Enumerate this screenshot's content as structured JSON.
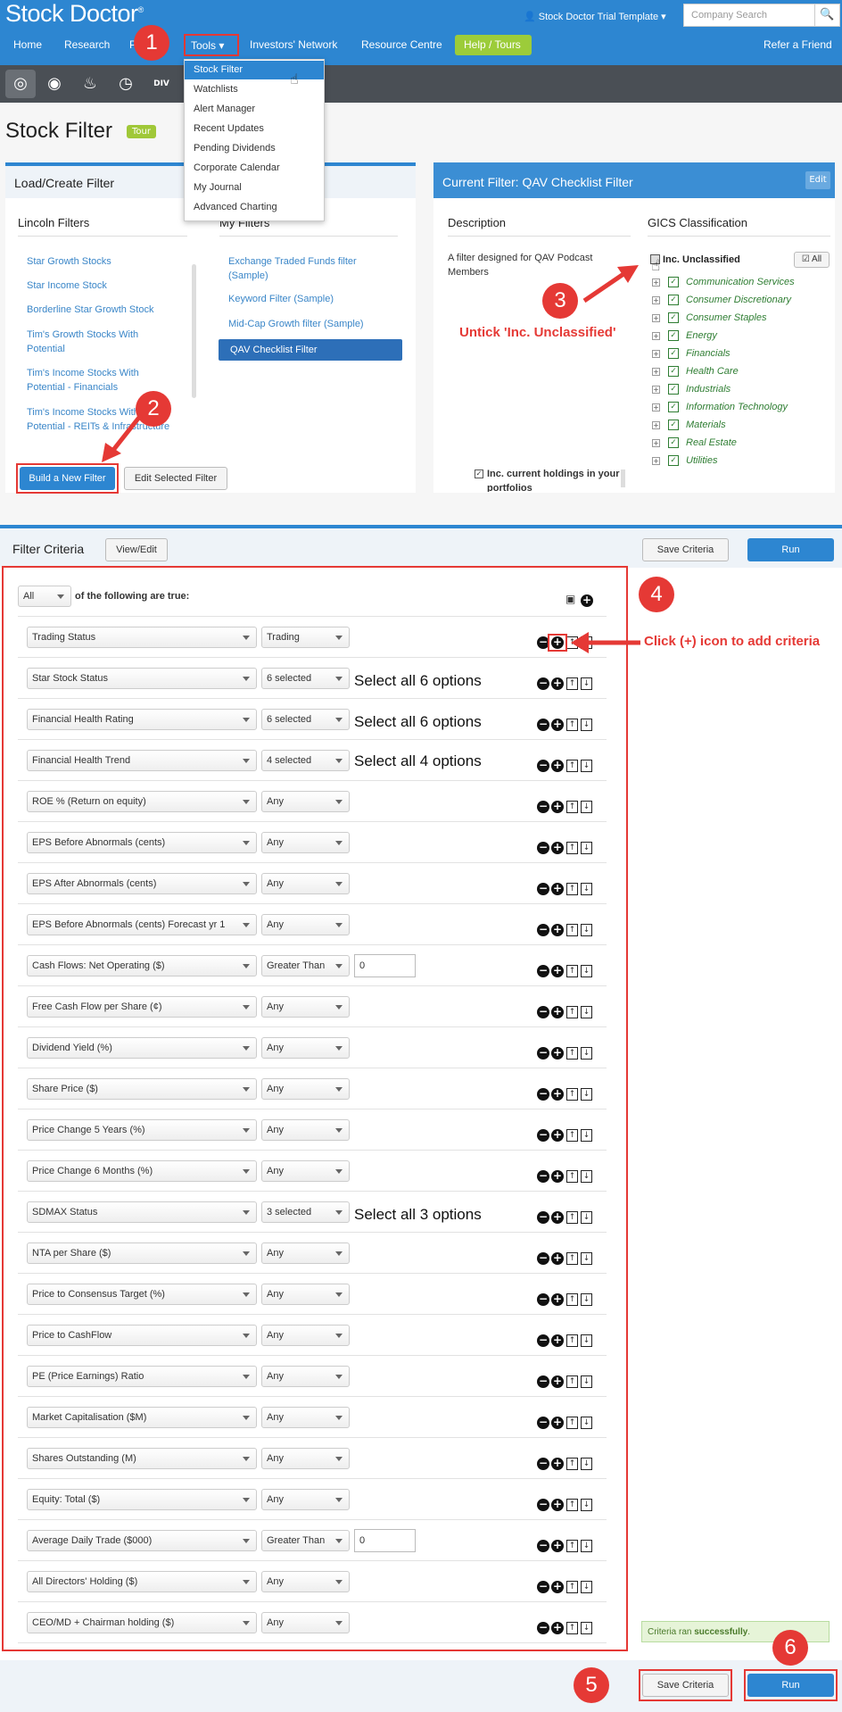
{
  "header": {
    "logo": "Stock Doctor",
    "user": "Stock Doctor Trial Template",
    "search_placeholder": "Company Search",
    "nav": [
      "Home",
      "Research",
      "P",
      "Tools",
      "Investors' Network",
      "Resource Centre",
      "Help / Tours",
      "Refer a Friend"
    ]
  },
  "toolbar": {
    "icons": [
      "target-icon",
      "binoculars-icon",
      "bell-icon",
      "alarm-clock-icon",
      "dividend-icon"
    ],
    "div_label": "DIV"
  },
  "tools_menu": [
    "Stock Filter",
    "Watchlists",
    "Alert Manager",
    "Recent Updates",
    "Pending Dividends",
    "Corporate Calendar",
    "My Journal",
    "Advanced Charting"
  ],
  "page": {
    "title": "Stock Filter",
    "tour": "Tour"
  },
  "load_panel": {
    "title": "Load/Create Filter",
    "lincoln_title": "Lincoln Filters",
    "my_title": "My Filters",
    "lincoln": [
      "Star Growth Stocks",
      "Star Income Stock",
      "Borderline Star Growth Stock",
      "Tim's Growth Stocks With Potential",
      "Tim's Income Stocks With Potential - Financials",
      "Tim's Income Stocks With Potential - REITs & Infrastructure"
    ],
    "my": [
      "Exchange Traded Funds filter (Sample)",
      "Keyword Filter (Sample)",
      "Mid-Cap Growth filter (Sample)",
      "QAV Checklist Filter"
    ],
    "build_btn": "Build a New Filter",
    "edit_btn": "Edit Selected Filter"
  },
  "current_panel": {
    "title": "Current Filter: QAV Checklist Filter",
    "edit": "Edit",
    "desc_title": "Description",
    "desc": "A filter designed for QAV Podcast Members",
    "holdings": "Inc. current holdings in your portfolios",
    "gics_title": "GICS Classification",
    "inc_unclassified": "Inc. Unclassified",
    "all": "All",
    "sectors": [
      "Communication Services",
      "Consumer Discretionary",
      "Consumer Staples",
      "Energy",
      "Financials",
      "Health Care",
      "Industrials",
      "Information Technology",
      "Materials",
      "Real Estate",
      "Utilities"
    ]
  },
  "criteria": {
    "title": "Filter Criteria",
    "view_edit": "View/Edit",
    "save": "Save Criteria",
    "run": "Run",
    "all_sel": "All",
    "all_text": "of the following are true:",
    "success_prefix": "Criteria ran ",
    "success_bold": "successfully",
    "success_suffix": ".",
    "rows": [
      {
        "field": "Trading Status",
        "op": "Trading"
      },
      {
        "field": "Star Stock Status",
        "op": "6 selected"
      },
      {
        "field": "Financial Health Rating",
        "op": "6 selected"
      },
      {
        "field": "Financial Health Trend",
        "op": "4 selected"
      },
      {
        "field": "ROE % (Return on equity)",
        "op": "Any"
      },
      {
        "field": "EPS Before Abnormals (cents)",
        "op": "Any"
      },
      {
        "field": "EPS After Abnormals (cents)",
        "op": "Any"
      },
      {
        "field": "EPS Before Abnormals (cents) Forecast yr 1",
        "op": "Any"
      },
      {
        "field": "Cash Flows: Net Operating ($)",
        "op": "Greater Than",
        "value": "0"
      },
      {
        "field": "Free Cash Flow per Share (¢)",
        "op": "Any"
      },
      {
        "field": "Dividend Yield (%)",
        "op": "Any"
      },
      {
        "field": "Share Price ($)",
        "op": "Any"
      },
      {
        "field": "Price Change 5 Years (%)",
        "op": "Any"
      },
      {
        "field": "Price Change 6 Months (%)",
        "op": "Any"
      },
      {
        "field": "SDMAX Status",
        "op": "3 selected"
      },
      {
        "field": "NTA per Share ($)",
        "op": "Any"
      },
      {
        "field": "Price to Consensus Target (%)",
        "op": "Any"
      },
      {
        "field": "Price to CashFlow",
        "op": "Any"
      },
      {
        "field": "PE (Price Earnings) Ratio",
        "op": "Any"
      },
      {
        "field": "Market Capitalisation ($M)",
        "op": "Any"
      },
      {
        "field": "Shares Outstanding (M)",
        "op": "Any"
      },
      {
        "field": "Equity: Total ($)",
        "op": "Any"
      },
      {
        "field": "Average Daily Trade ($000)",
        "op": "Greater Than",
        "value": "0"
      },
      {
        "field": "All Directors' Holding ($)",
        "op": "Any"
      },
      {
        "field": "CEO/MD + Chairman holding ($)",
        "op": "Any"
      }
    ]
  },
  "annotations": {
    "badges": [
      "1",
      "2",
      "3",
      "4",
      "5",
      "6"
    ],
    "untick": "Untick 'Inc. Unclassified'",
    "click_add": "Click (+) icon to add criteria",
    "select6a": "Select all 6 options",
    "select6b": "Select all 6 options",
    "select4": "Select all 4 options",
    "select3": "Select all 3 options"
  },
  "colors": {
    "brand": "#2d86d1",
    "annotation": "#e53935",
    "help": "#9ccc3a",
    "sector": "#2e7d32"
  }
}
